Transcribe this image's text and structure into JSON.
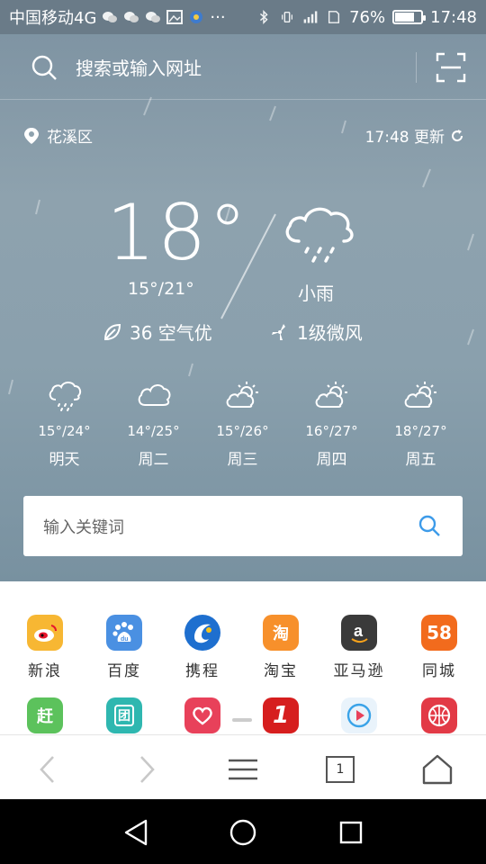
{
  "status_bar": {
    "carrier": "中国移动4G",
    "battery_text": "76%",
    "battery_level": 0.76,
    "time": "17:48"
  },
  "top_search": {
    "placeholder": "搜索或输入网址"
  },
  "weather": {
    "location": "花溪区",
    "updated": "17:48 更新",
    "temperature": "18°",
    "range": "15°/21°",
    "condition": "小雨",
    "aqi": "36 空气优",
    "wind": "1级微风",
    "forecast": [
      {
        "temp": "15°/24°",
        "day": "明天",
        "icon": "rain-cloud-icon"
      },
      {
        "temp": "14°/25°",
        "day": "周二",
        "icon": "cloud-icon"
      },
      {
        "temp": "15°/26°",
        "day": "周三",
        "icon": "partly-cloudy-icon"
      },
      {
        "temp": "16°/27°",
        "day": "周四",
        "icon": "partly-cloudy-icon"
      },
      {
        "temp": "18°/27°",
        "day": "周五",
        "icon": "partly-cloudy-icon"
      }
    ]
  },
  "keyword_search": {
    "placeholder": "输入关键词"
  },
  "apps": [
    {
      "label": "新浪",
      "icon": "weibo-icon",
      "color": "#f7b733"
    },
    {
      "label": "百度",
      "icon": "baidu-icon",
      "color": "#4a90e2"
    },
    {
      "label": "携程",
      "icon": "ctrip-icon",
      "color": "#1e6fcf"
    },
    {
      "label": "淘宝",
      "icon": "taobao-icon",
      "color": "#f7902b",
      "glyph": "淘"
    },
    {
      "label": "亚马逊",
      "icon": "amazon-icon",
      "color": "#3a3a3a",
      "glyph": "a"
    },
    {
      "label": "同城",
      "icon": "58-icon",
      "color": "#f26b1d",
      "glyph": "58"
    }
  ],
  "apps_row2": [
    {
      "icon": "ganji-icon",
      "color": "#5cc25c",
      "glyph": "赶"
    },
    {
      "icon": "tuan-icon",
      "color": "#2fb7b0",
      "glyph": "团"
    },
    {
      "icon": "heart-app-icon",
      "color": "#e8415a"
    },
    {
      "icon": "yhd-icon",
      "color": "#d61e1e",
      "glyph": "1"
    },
    {
      "icon": "video-play-icon",
      "color": "#e9f3fb"
    },
    {
      "icon": "basketball-icon",
      "color": "#e23a46"
    }
  ],
  "browser_nav": {
    "tab_count": "1"
  }
}
